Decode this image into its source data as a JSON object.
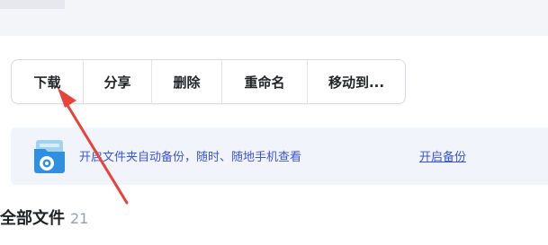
{
  "toolbar": {
    "download_label": "下载",
    "share_label": "分享",
    "delete_label": "删除",
    "rename_label": "重命名",
    "move_label": "移动到..."
  },
  "banner": {
    "text": "开启文件夹自动备份，随时、随地手机查看",
    "link": "开启备份",
    "icon": "folder-backup-icon"
  },
  "files": {
    "title": "全部文件",
    "count": "21"
  },
  "annotation": {
    "arrow_color": "#e8433a",
    "icon": "red-arrow"
  },
  "colors": {
    "accent": "#3a55d8",
    "banner_bg": "#f2f4fb"
  }
}
